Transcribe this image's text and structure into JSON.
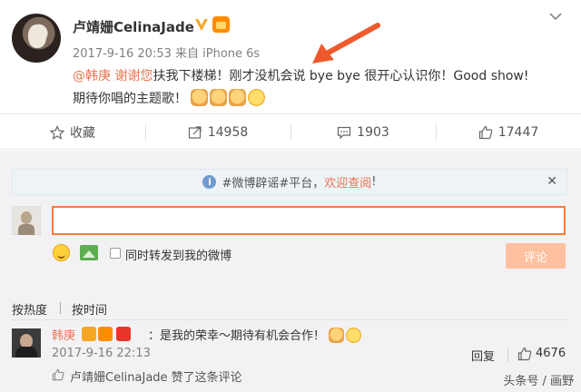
{
  "post": {
    "username": "卢靖姗CelinaJade",
    "meta": "2017-9-16 20:53 来自 iPhone 6s",
    "mention": "@韩庚",
    "highlight": "谢谢您",
    "text_line1": "扶我下楼梯！刚才没机会说 bye bye 很开心认识你！Good show!",
    "text_line2": "期待你唱的主题歌！"
  },
  "actions": {
    "favorite": "收藏",
    "repost": "14958",
    "comment": "1903",
    "like": "17447"
  },
  "comment_box": {
    "notice_prefix": "#微博辟谣#平台，",
    "notice_link": "欢迎查阅",
    "notice_suffix": "!",
    "input_value": "",
    "repost_label": "同时转发到我的微博",
    "submit_label": "评论"
  },
  "sort": {
    "by_hot": "按热度",
    "by_time": "按时间"
  },
  "comment": {
    "user": "韩庚",
    "text": "：是我的荣幸～期待有机会合作！",
    "time": "2017-9-16 22:13",
    "reply_label": "回复",
    "like_count": "4676",
    "liked_note": "卢靖姗CelinaJade 赞了这条评论"
  },
  "watermark": "头条号 / 画野",
  "colors": {
    "accent": "#eb7350",
    "input_border": "#fa7d3c",
    "submit_bg": "#ffc09f",
    "arrow": "#ee5a2e"
  },
  "icons": [
    "chevron-down-icon",
    "verified-icon",
    "vip-icon",
    "star-icon",
    "share-icon",
    "comment-icon",
    "thumbs-up-icon",
    "info-icon",
    "close-icon",
    "emoji-icon",
    "image-icon"
  ]
}
